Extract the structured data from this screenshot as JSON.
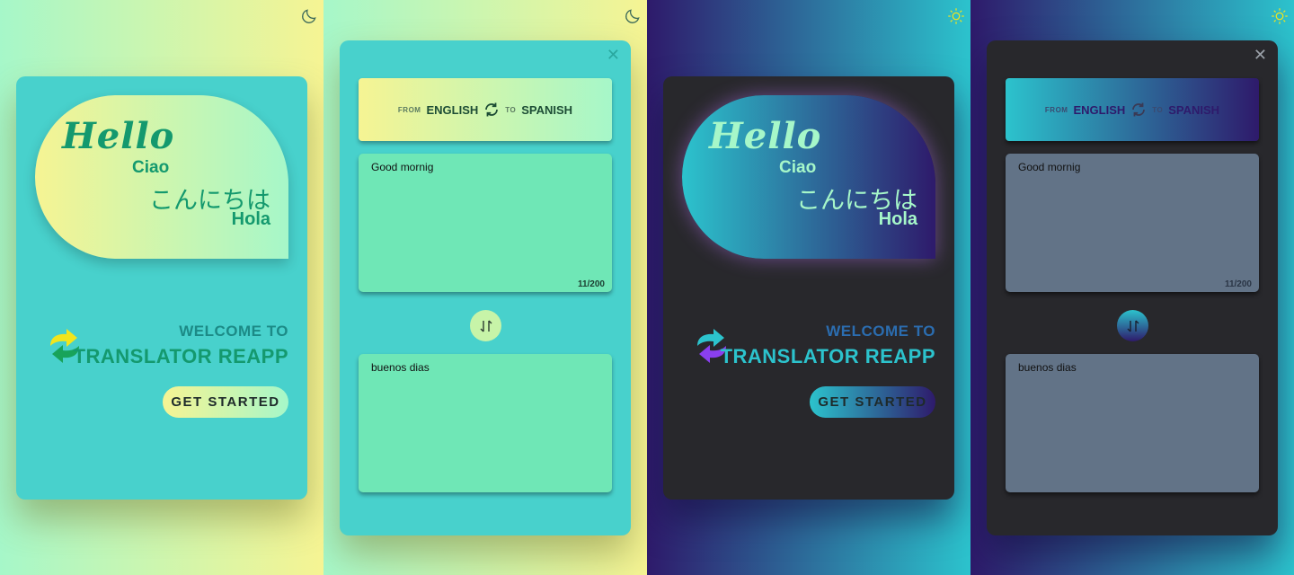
{
  "colors": {
    "light_bg_start": "#a6f7c9",
    "light_bg_end": "#f6f493",
    "light_card": "#48d1cc",
    "dark_bg_start": "#2e1a6b",
    "dark_bg_end": "#2cc3cd",
    "dark_card": "#28282c",
    "accent_green": "#14996e"
  },
  "welcome": {
    "greetings": {
      "hello": "Hello",
      "ciao": "Ciao",
      "japanese": "こんにちは",
      "hola": "Hola"
    },
    "subtitle": "WELCOME TO",
    "title": "TRANSLATOR REAPP",
    "cta_label": "GET STARTED",
    "logo_icon": "translate-arrows-icon"
  },
  "translator": {
    "from_label": "FROM",
    "from_language": "ENGLISH",
    "to_label": "TO",
    "to_language": "SPANISH",
    "input_text": "Good mornig",
    "char_counter": "11/200",
    "output_text": "buenos dias",
    "close_icon": "close-icon",
    "swap_icon": "swap-vertical-icon"
  },
  "theme_icons": {
    "light_mode_toggle": "moon-icon",
    "dark_mode_toggle": "sun-icon"
  }
}
